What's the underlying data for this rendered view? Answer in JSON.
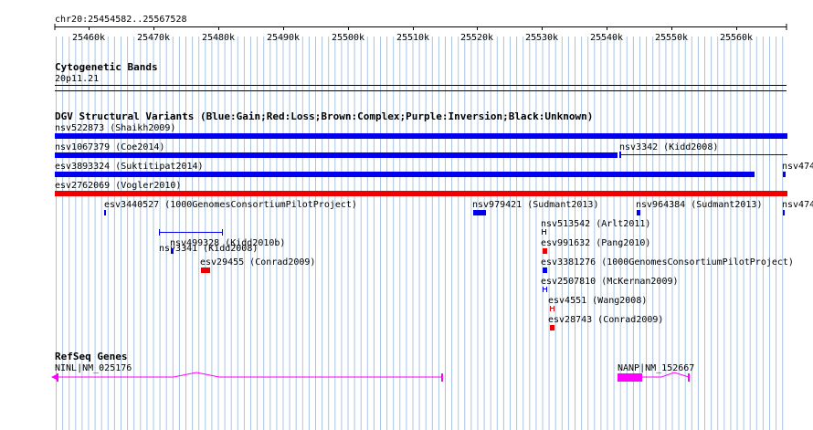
{
  "ruler": {
    "range_label": "chr20:25454582..25567528",
    "ticks": [
      "25460k",
      "25470k",
      "25480k",
      "25490k",
      "25500k",
      "25510k",
      "25520k",
      "25530k",
      "25540k",
      "25550k",
      "25560k"
    ]
  },
  "cytoband": {
    "title": "Cytogenetic Bands",
    "band": "20p11.21"
  },
  "dgv": {
    "title": "DGV Structural Variants (Blue:Gain;Red:Loss;Brown:Complex;Purple:Inversion;Black:Unknown)",
    "variants": [
      {
        "label": "nsv522873 (Shaikh2009)"
      },
      {
        "label": "nsv1067379 (Coe2014)"
      },
      {
        "label": "nsv3342 (Kidd2008)"
      },
      {
        "label": "esv3893324 (Suktitipat2014)"
      },
      {
        "label": "nsv474"
      },
      {
        "label": "esv2762069 (Vogler2010)"
      },
      {
        "label": "esv3440527 (1000GenomesConsortiumPilotProject)"
      },
      {
        "label": "nsv979421 (Sudmant2013)"
      },
      {
        "label": "nsv964384 (Sudmant2013)"
      },
      {
        "label": "nsv474"
      },
      {
        "label": "nsv3341 (Kidd2008)"
      },
      {
        "label": "nsv513542 (Arlt2011)"
      },
      {
        "label": "nsv499328 (Kidd2010b)"
      },
      {
        "label": "esv991632 (Pang2010)"
      },
      {
        "label": "esv29455 (Conrad2009)"
      },
      {
        "label": "esv3381276 (1000GenomesConsortiumPilotProject)"
      },
      {
        "label": "esv2507810 (McKernan2009)"
      },
      {
        "label": "esv4551 (Wang2008)"
      },
      {
        "label": "esv28743 (Conrad2009)"
      }
    ]
  },
  "refseq": {
    "title": "RefSeq Genes",
    "genes": [
      {
        "label": "NINL|NM_025176"
      },
      {
        "label": "NANP|NM_152667"
      }
    ]
  },
  "colors": {
    "gain": "#0000ee",
    "loss": "#ee0000",
    "gene": "#ff00ff",
    "grid": "#a8c4e4"
  }
}
